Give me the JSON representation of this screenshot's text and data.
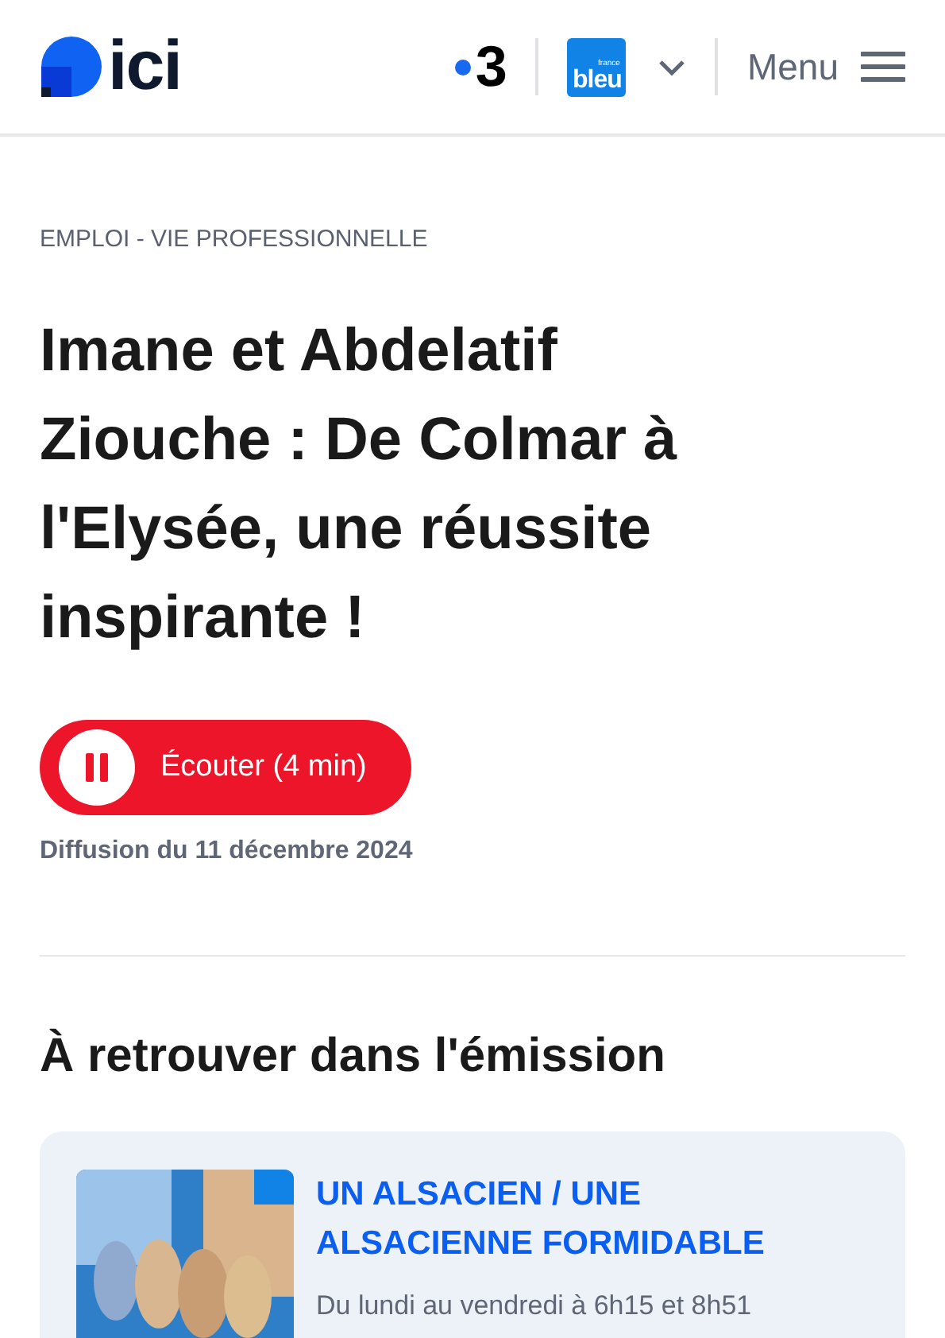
{
  "header": {
    "logo": "ici",
    "channel_logo": "3",
    "station_logo": {
      "top": "france",
      "main": "bleu"
    },
    "menu_label": "Menu"
  },
  "article": {
    "category": "EMPLOI - VIE PROFESSIONNELLE",
    "title": "Imane et Abdelatif Ziouche : De Colmar à l'Elysée, une réussite inspirante !",
    "player": {
      "label": "Écouter (4 min)",
      "playing": true
    },
    "date": "Diffusion du 11 décembre 2024"
  },
  "section": {
    "heading": "À retrouver dans l'émission",
    "show": {
      "kind": "picture",
      "title": "UN ALSACIEN / UNE ALSACIENNE FORMIDABLE",
      "schedule": "Du lundi au vendredi à 6h15 et 8h51"
    }
  }
}
